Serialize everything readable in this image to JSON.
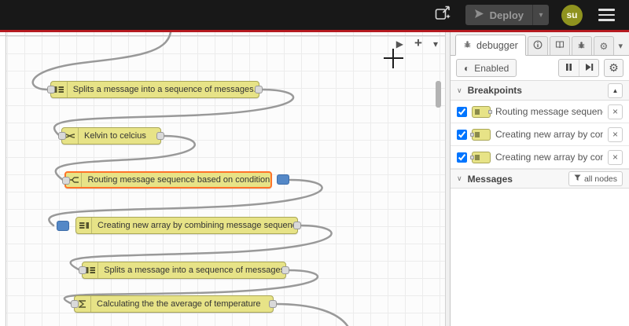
{
  "header": {
    "deploy_label": "Deploy",
    "avatar_label": "su"
  },
  "canvas": {
    "nodes": [
      {
        "label": "Splits a message into a sequence of messages."
      },
      {
        "label": "Kelvin to celcius"
      },
      {
        "label": "Routing message sequence based on condition"
      },
      {
        "label": "Creating new array by combining message sequence"
      },
      {
        "label": "Splits a message into a sequence of messages."
      },
      {
        "label": "Calculating the the average of temperature"
      }
    ]
  },
  "sidebar": {
    "tab_label": "debugger",
    "enabled_label": "Enabled",
    "breakpoints": {
      "title": "Breakpoints",
      "items": [
        {
          "label": "Routing message sequence ba"
        },
        {
          "label": "Creating new array by combini"
        },
        {
          "label": "Creating new array by combini"
        }
      ]
    },
    "messages": {
      "title": "Messages",
      "filter_label": "all nodes"
    }
  },
  "icons": {
    "play": "▶",
    "plus": "+",
    "dropdown": "▾",
    "section_chevron": "∨",
    "enabled_toggle": "◐",
    "collapse": "▲",
    "close": "×",
    "gear": "⚙"
  },
  "colors": {
    "header_bg": "#181818",
    "accent_red": "#b51a20",
    "node_fill": "#e7e387",
    "node_selected_border": "#ff7428",
    "breakpoint_blue": "#5488c7",
    "wire": "#999999"
  }
}
